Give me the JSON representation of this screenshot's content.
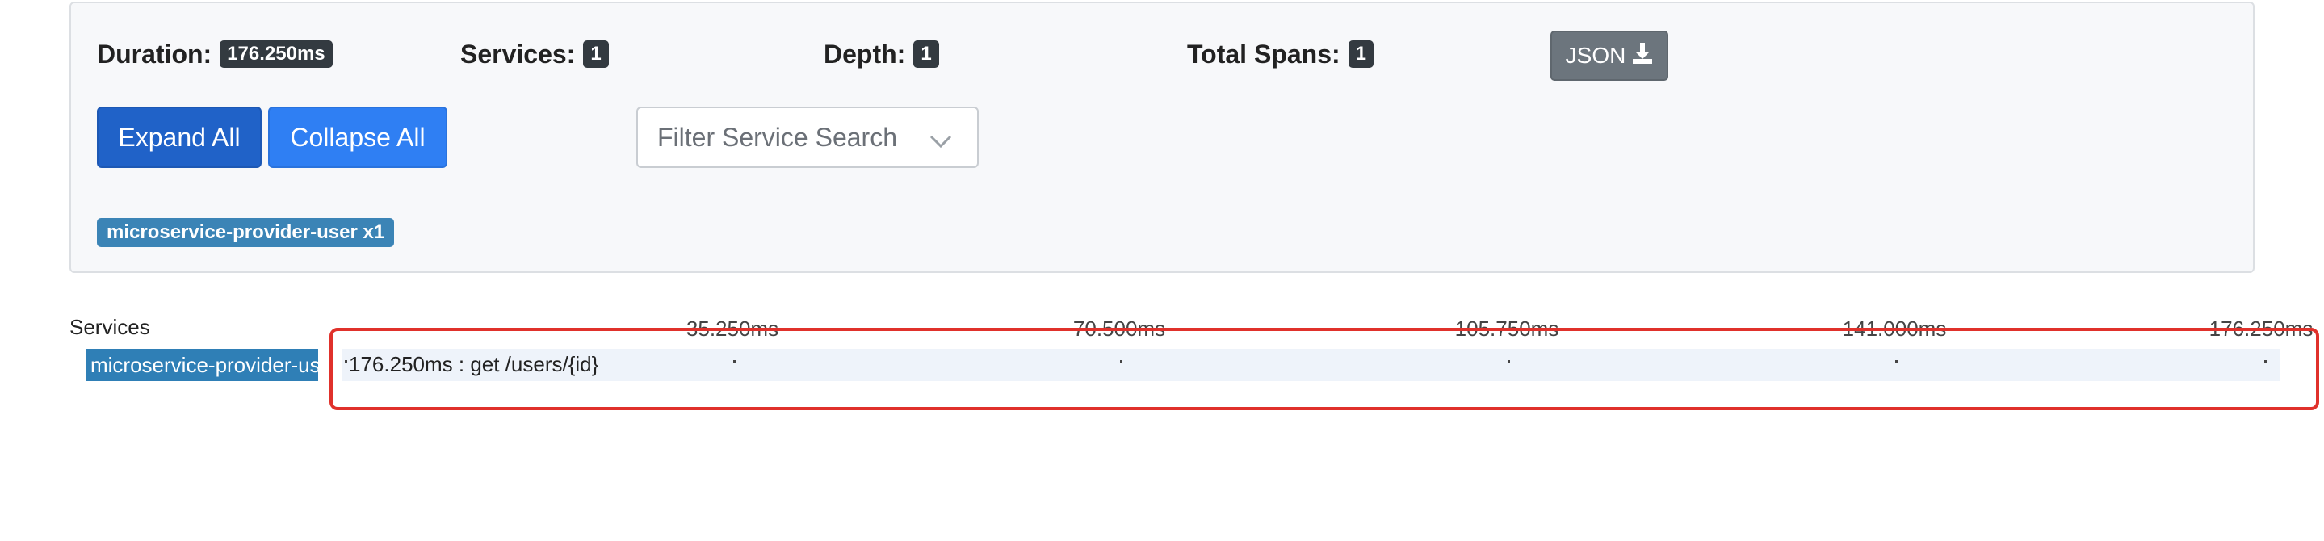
{
  "summary": {
    "duration": {
      "label": "Duration:",
      "value": "176.250ms"
    },
    "services": {
      "label": "Services:",
      "value": "1"
    },
    "depth": {
      "label": "Depth:",
      "value": "1"
    },
    "total_spans": {
      "label": "Total Spans:",
      "value": "1"
    },
    "json_button": "JSON"
  },
  "controls": {
    "expand_all": "Expand All",
    "collapse_all": "Collapse All",
    "filter_placeholder": "Filter Service Search"
  },
  "service_tags": [
    {
      "label": "microservice-provider-user x1"
    }
  ],
  "timeline": {
    "services_header": "Services",
    "ticks": [
      "35.250ms",
      "70.500ms",
      "105.750ms",
      "141.000ms",
      "176.250ms"
    ],
    "rows": [
      {
        "service": "microservice-provider-user",
        "span": "176.250ms : get /users/{id}"
      }
    ]
  },
  "colors": {
    "badge": "#333a40",
    "expand": "#2062c8",
    "collapse": "#2f7ff3",
    "service": "#3b84b6",
    "highlight": "#e0312b"
  }
}
